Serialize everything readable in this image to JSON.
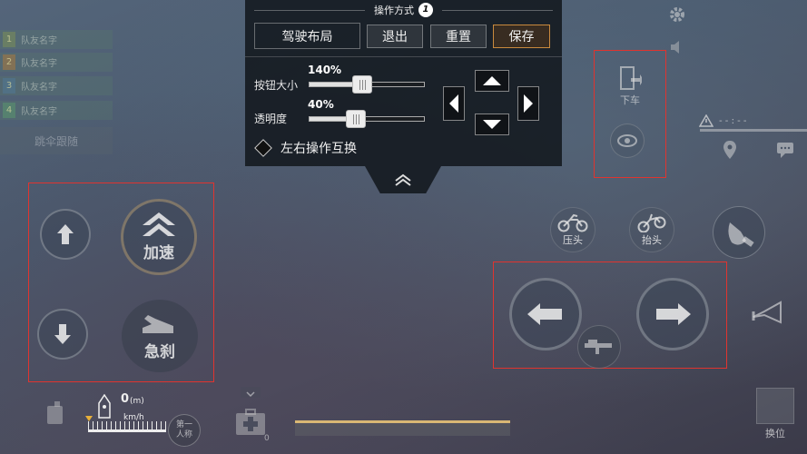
{
  "team": {
    "members": [
      {
        "num": "1",
        "name": "队友名字"
      },
      {
        "num": "2",
        "name": "队友名字"
      },
      {
        "num": "3",
        "name": "队友名字"
      },
      {
        "num": "4",
        "name": "队友名字"
      }
    ],
    "follow_label": "跳伞跟随"
  },
  "panel": {
    "title": "操作方式",
    "title_badge": "1",
    "layout_button": "驾驶布局",
    "exit_button": "退出",
    "reset_button": "重置",
    "save_button": "保存",
    "size_label": "按钮大小",
    "size_value": "140%",
    "size_fill": 0.45,
    "opacity_label": "透明度",
    "opacity_value": "40%",
    "opacity_fill": 0.4,
    "swap_label": "左右操作互换"
  },
  "left_controls": {
    "accelerate_label": "加速",
    "brake_label": "急刹"
  },
  "right_hud": {
    "exit_vehicle_label": "下车",
    "signal_text": "- - : - -",
    "press_head_label": "压头",
    "lift_head_label": "抬头",
    "switch_seat_label": "换位"
  },
  "bottom_hud": {
    "speed_value": "0",
    "speed_unit": "(m)",
    "speed_label": "km/h",
    "first_person_label": "第一人称",
    "ammo": "0",
    "progress": 0.0
  },
  "colors": {
    "highlight_border": "#e0342f",
    "save_border": "#c98a3e"
  }
}
